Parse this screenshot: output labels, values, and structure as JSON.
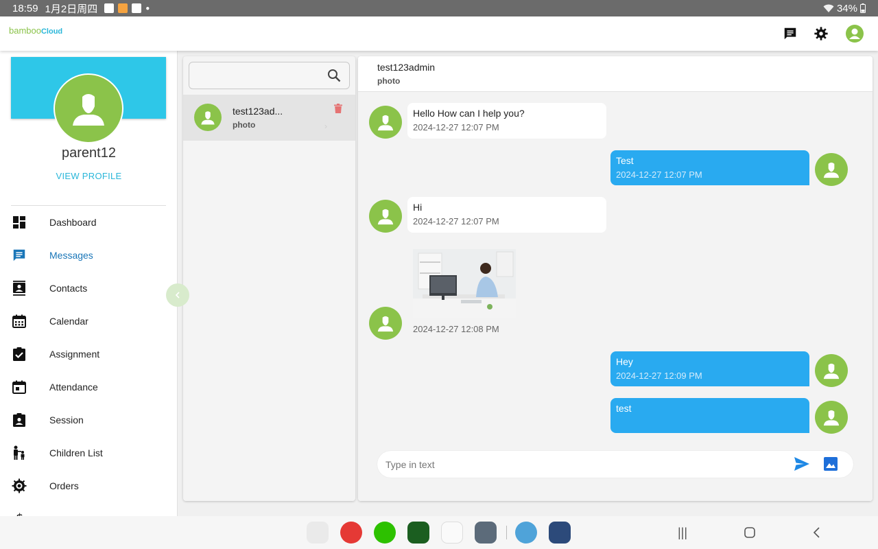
{
  "status_bar": {
    "time": "18:59",
    "date": "1月2日周四",
    "battery": "34%"
  },
  "header": {
    "logo_part1": "bamboo",
    "logo_part2": "Cloud",
    "icons": [
      "message-icon",
      "gear-icon",
      "account-icon"
    ]
  },
  "profile": {
    "name": "parent12",
    "view_profile": "VIEW PROFILE"
  },
  "sidebar": {
    "items": [
      {
        "label": "Dashboard",
        "icon": "dashboard-icon"
      },
      {
        "label": "Messages",
        "icon": "chat-icon",
        "active": true
      },
      {
        "label": "Contacts",
        "icon": "contacts-icon"
      },
      {
        "label": "Calendar",
        "icon": "calendar-icon"
      },
      {
        "label": "Assignment",
        "icon": "assignment-icon"
      },
      {
        "label": "Attendance",
        "icon": "attendance-icon"
      },
      {
        "label": "Session",
        "icon": "session-icon"
      },
      {
        "label": "Children List",
        "icon": "children-icon"
      },
      {
        "label": "Orders",
        "icon": "orders-icon"
      }
    ]
  },
  "conversations": {
    "search_placeholder": "",
    "items": [
      {
        "name": "test123ad...",
        "last_message": "photo"
      }
    ]
  },
  "chat": {
    "title": "test123admin",
    "subtitle": "photo",
    "messages": [
      {
        "direction": "in",
        "text": "Hello How can I help you?",
        "time": "2024-12-27 12:07 PM"
      },
      {
        "direction": "out",
        "text": "Test",
        "time": "2024-12-27 12:07 PM"
      },
      {
        "direction": "in",
        "text": "Hi",
        "time": "2024-12-27 12:07 PM"
      },
      {
        "direction": "in",
        "type": "image",
        "time": "2024-12-27 12:08 PM"
      },
      {
        "direction": "out",
        "text": "Hey",
        "time": "2024-12-27 12:09 PM"
      },
      {
        "direction": "out",
        "text": "test",
        "time": ""
      }
    ],
    "input_placeholder": "Type in text"
  },
  "colors": {
    "brand_green": "#8bc34a",
    "brand_cyan": "#2ec7e8",
    "outgoing_bubble": "#29aaf0",
    "active_nav": "#1976b8",
    "delete_red": "#e57373"
  }
}
